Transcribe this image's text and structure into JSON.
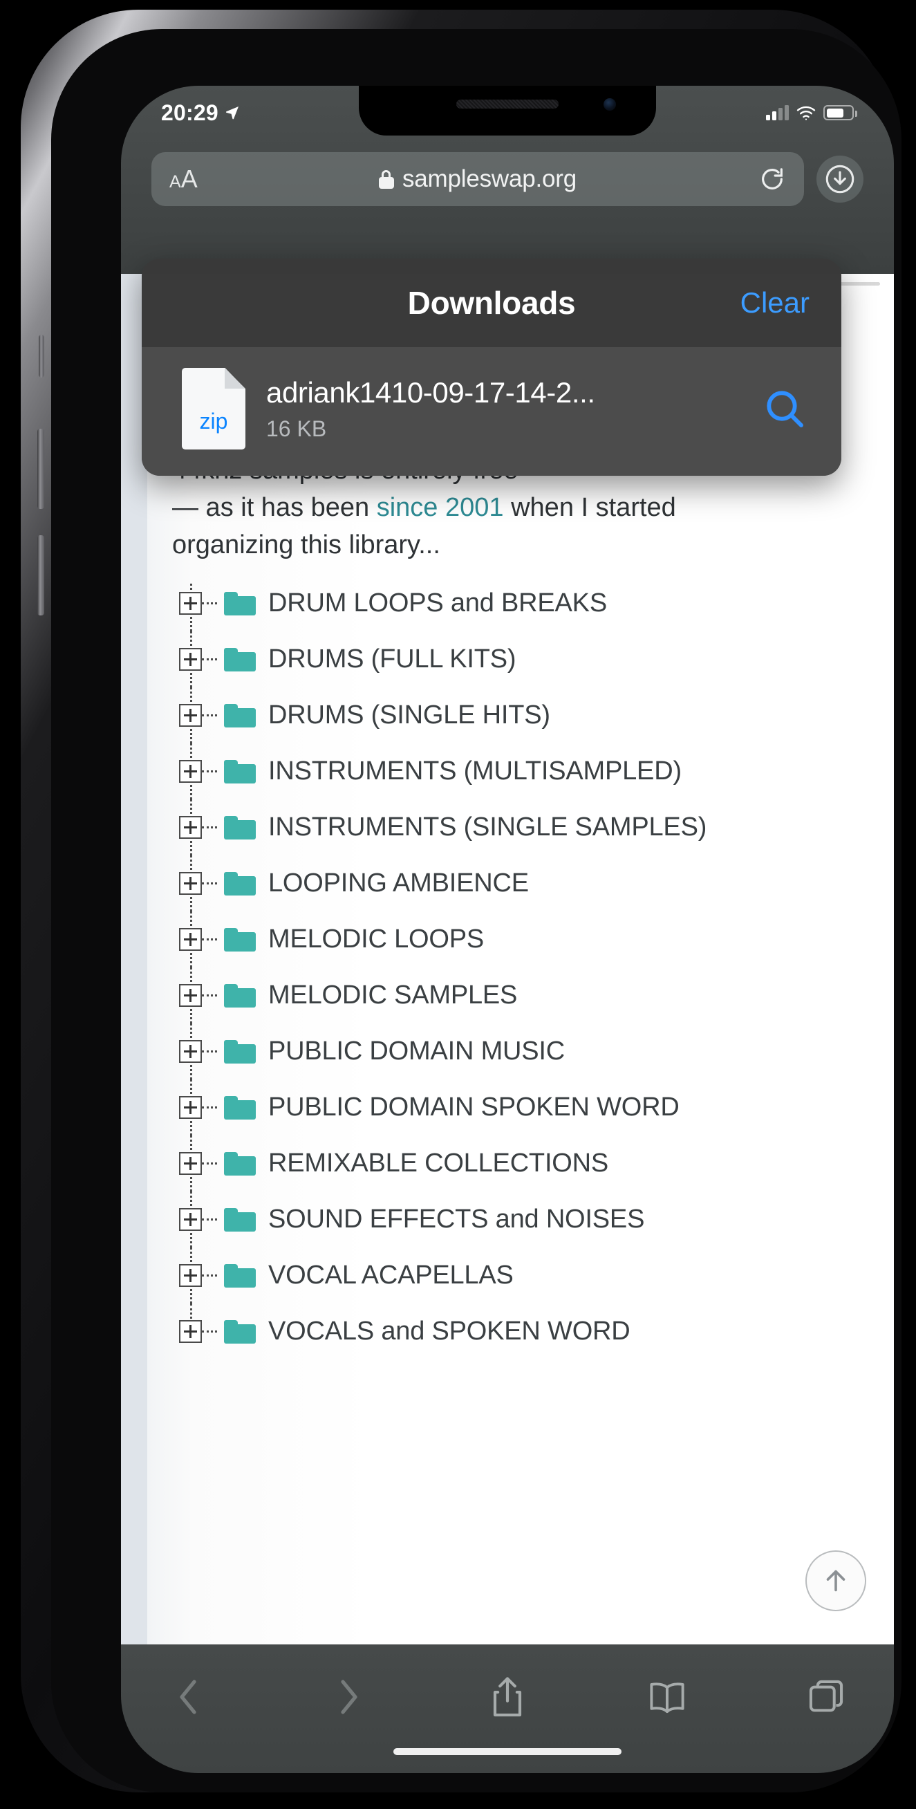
{
  "status_bar": {
    "time": "20:29",
    "location_icon": "location-arrow-icon",
    "signal_icon": "cellular-signal-icon",
    "wifi_icon": "wifi-icon",
    "battery_icon": "battery-icon"
  },
  "browser": {
    "text_size_small": "A",
    "text_size_large": "A",
    "lock_icon": "lock-icon",
    "url": "sampleswap.org",
    "reload_icon": "reload-icon",
    "downloads_icon": "downloads-arrow-icon"
  },
  "downloads_panel": {
    "title": "Downloads",
    "clear_label": "Clear",
    "items": [
      {
        "file_type": "zip",
        "name": "adriank1410-09-17-14-2...",
        "size": "16 KB",
        "search_icon": "search-icon"
      }
    ]
  },
  "page": {
    "blurb_line1": "44khz samples is entirely free",
    "blurb_line2_pre": "— as it has been ",
    "blurb_link": "since 2001",
    "blurb_line2_post": " when I started",
    "blurb_line3": "organizing this library...",
    "folders": [
      "DRUM LOOPS and BREAKS",
      "DRUMS (FULL KITS)",
      "DRUMS (SINGLE HITS)",
      "INSTRUMENTS (MULTISAMPLED)",
      "INSTRUMENTS (SINGLE SAMPLES)",
      "LOOPING AMBIENCE",
      "MELODIC LOOPS",
      "MELODIC SAMPLES",
      "PUBLIC DOMAIN MUSIC",
      "PUBLIC DOMAIN SPOKEN WORD",
      "REMIXABLE COLLECTIONS",
      "SOUND EFFECTS and NOISES",
      "VOCAL ACAPELLAS",
      "VOCALS and SPOKEN WORD"
    ],
    "expander_symbol": "+",
    "scroll_top_icon": "scroll-to-top-icon"
  },
  "toolbar": {
    "back_icon": "back-chevron-icon",
    "forward_icon": "forward-chevron-icon",
    "share_icon": "share-icon",
    "bookmarks_icon": "book-icon",
    "tabs_icon": "tabs-icon"
  },
  "colors": {
    "accent_blue": "#3c9cff",
    "folder_teal": "#3fb3aa",
    "link_teal": "#2e8b94",
    "zip_blue": "#0a84ff"
  }
}
